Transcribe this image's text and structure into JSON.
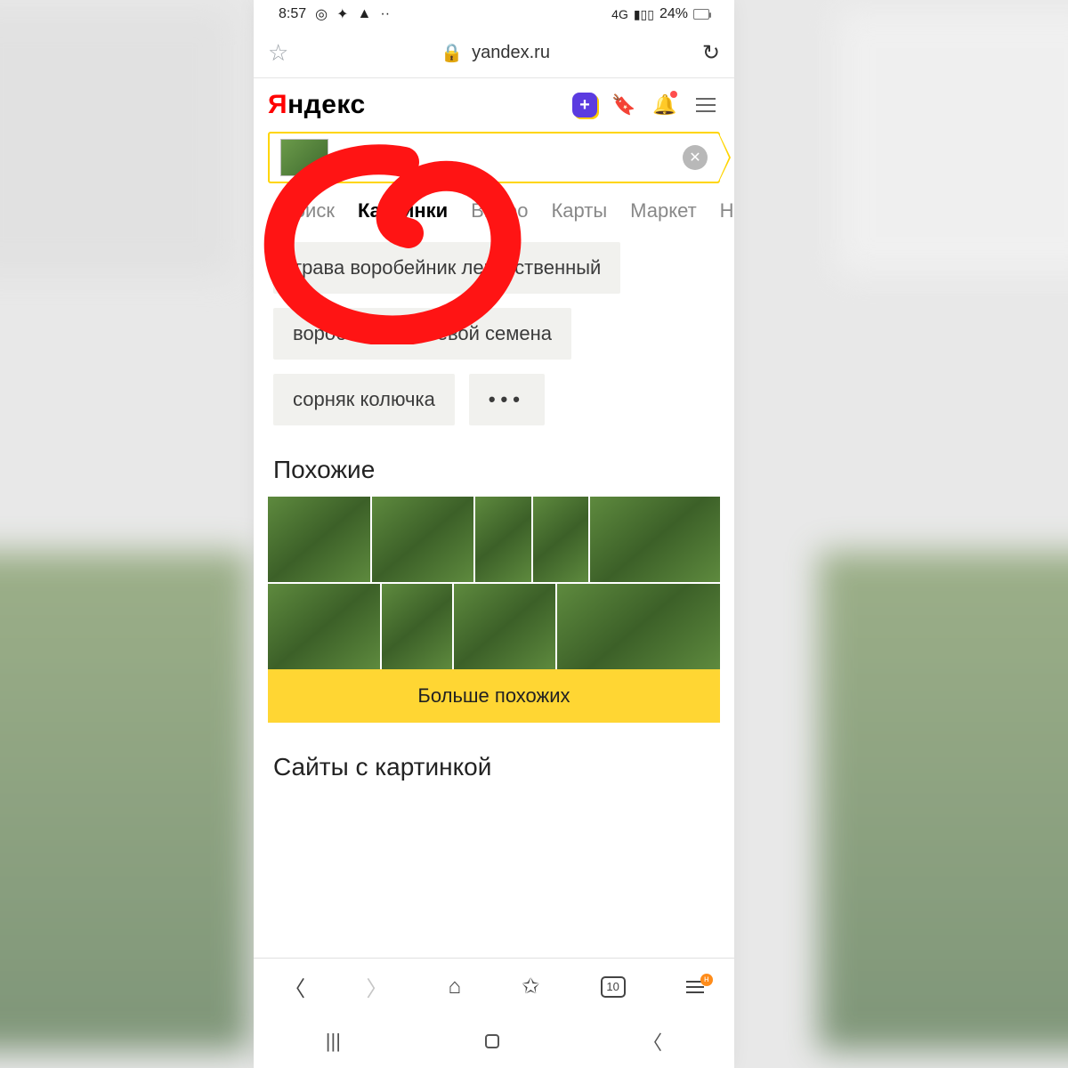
{
  "status": {
    "time": "8:57",
    "net": "4G",
    "battery": "24%"
  },
  "url": {
    "domain": "yandex.ru"
  },
  "logo": {
    "first": "Я",
    "rest": "ндекс"
  },
  "tabs": [
    {
      "label": "Поиск",
      "active": false
    },
    {
      "label": "Картинки",
      "active": true
    },
    {
      "label": "Видео",
      "active": false
    },
    {
      "label": "Карты",
      "active": false
    },
    {
      "label": "Маркет",
      "active": false
    },
    {
      "label": "Но",
      "active": false
    }
  ],
  "chips": [
    "трава воробейник лекарственный",
    "воробейник полевой семена",
    "сорняк колючка"
  ],
  "chip_more": "•••",
  "similar_heading": "Похожие",
  "more_similar": "Больше похожих",
  "sites_heading": "Сайты с картинкой",
  "bottom": {
    "tab_count": "10",
    "stack_badge": "н"
  }
}
